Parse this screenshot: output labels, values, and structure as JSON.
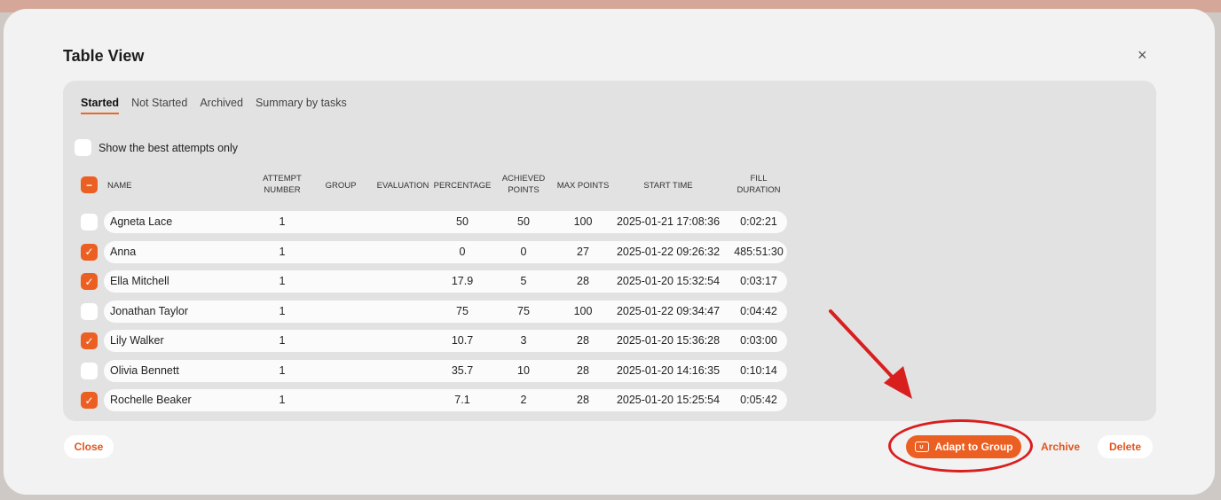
{
  "modal": {
    "title": "Table View",
    "close_symbol": "×"
  },
  "tabs": [
    {
      "label": "Started",
      "active": true
    },
    {
      "label": "Not Started",
      "active": false
    },
    {
      "label": "Archived",
      "active": false
    },
    {
      "label": "Summary by tasks",
      "active": false
    }
  ],
  "best_attempts": {
    "label": "Show the best attempts only",
    "checked": false
  },
  "columns": {
    "name": "NAME",
    "attempt_1": "ATTEMPT",
    "attempt_2": "NUMBER",
    "group": "GROUP",
    "evaluation": "EVALUATION",
    "percentage": "PERCENTAGE",
    "achieved_1": "ACHIEVED",
    "achieved_2": "POINTS",
    "max_points": "MAX POINTS",
    "start_time": "START TIME",
    "fill_1": "FILL",
    "fill_2": "DURATION"
  },
  "master_checkbox": {
    "state": "indeterminate",
    "symbol": "−"
  },
  "check_symbol": "✓",
  "rows": [
    {
      "name": "Agneta Lace",
      "attempt": "1",
      "group": "",
      "evaluation": "",
      "percentage": "50",
      "achieved": "50",
      "max": "100",
      "start": "2025-01-21 17:08:36",
      "duration": "0:02:21",
      "checked": false
    },
    {
      "name": "Anna",
      "attempt": "1",
      "group": "",
      "evaluation": "",
      "percentage": "0",
      "achieved": "0",
      "max": "27",
      "start": "2025-01-22 09:26:32",
      "duration": "485:51:30",
      "checked": true
    },
    {
      "name": "Ella Mitchell",
      "attempt": "1",
      "group": "",
      "evaluation": "",
      "percentage": "17.9",
      "achieved": "5",
      "max": "28",
      "start": "2025-01-20 15:32:54",
      "duration": "0:03:17",
      "checked": true
    },
    {
      "name": "Jonathan Taylor",
      "attempt": "1",
      "group": "",
      "evaluation": "",
      "percentage": "75",
      "achieved": "75",
      "max": "100",
      "start": "2025-01-22 09:34:47",
      "duration": "0:04:42",
      "checked": false
    },
    {
      "name": "Lily Walker",
      "attempt": "1",
      "group": "",
      "evaluation": "",
      "percentage": "10.7",
      "achieved": "3",
      "max": "28",
      "start": "2025-01-20 15:36:28",
      "duration": "0:03:00",
      "checked": true
    },
    {
      "name": "Olivia Bennett",
      "attempt": "1",
      "group": "",
      "evaluation": "",
      "percentage": "35.7",
      "achieved": "10",
      "max": "28",
      "start": "2025-01-20 14:16:35",
      "duration": "0:10:14",
      "checked": false
    },
    {
      "name": "Rochelle Beaker",
      "attempt": "1",
      "group": "",
      "evaluation": "",
      "percentage": "7.1",
      "achieved": "2",
      "max": "28",
      "start": "2025-01-20 15:25:54",
      "duration": "0:05:42",
      "checked": true
    }
  ],
  "footer": {
    "close_label": "Close",
    "adapt_label": "Adapt to Group",
    "archive_label": "Archive",
    "delete_label": "Delete"
  },
  "colors": {
    "accent": "#ec5f22",
    "annotation": "#d91e1e"
  }
}
